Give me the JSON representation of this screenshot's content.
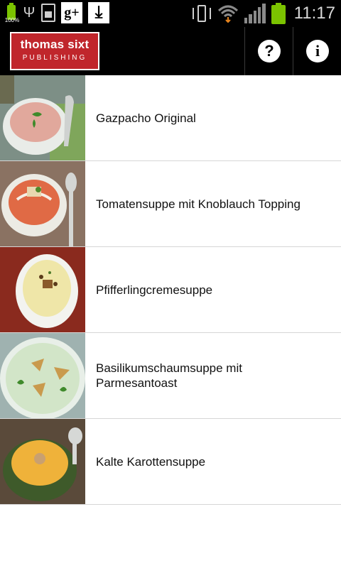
{
  "status_bar": {
    "battery_small_percent": "100%",
    "time": "11:17",
    "icons": [
      "battery-icon",
      "usb-icon",
      "sim-card-icon",
      "google-plus-icon",
      "download-icon",
      "vibrate-icon",
      "wifi-icon",
      "signal-icon",
      "battery-icon"
    ]
  },
  "action_bar": {
    "logo_line1": "thomas sixt",
    "logo_line2": "PUBLISHING",
    "help_icon_glyph": "?",
    "info_icon_glyph": "i",
    "colors": {
      "logo_red": "#c0262c",
      "bar_bg": "#000000"
    }
  },
  "recipes": [
    {
      "title": "Gazpacho Original"
    },
    {
      "title": "Tomatensuppe mit Knoblauch Topping"
    },
    {
      "title": "Pfifferlingcremesuppe"
    },
    {
      "title": "Basilikumschaumsuppe mit Parmesantoast"
    },
    {
      "title": "Kalte Karottensuppe"
    }
  ]
}
